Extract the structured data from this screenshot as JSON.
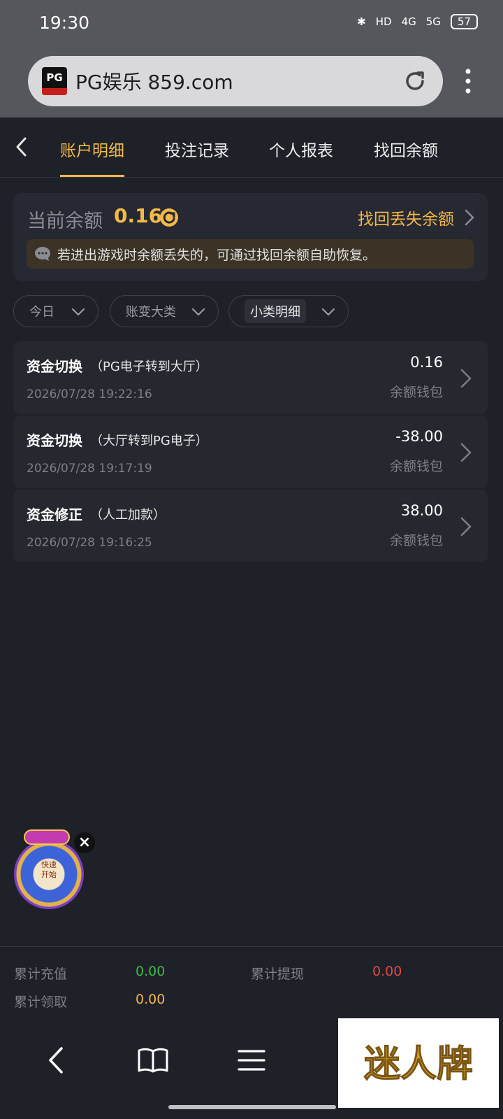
{
  "status_bar": {
    "time": "19:30",
    "network_1": "4G",
    "network_2": "5G",
    "hd": "HD",
    "battery": "57"
  },
  "browser": {
    "logo_text": "PG",
    "url": "PG娱乐 859.com"
  },
  "tabs": [
    {
      "label": "账户明细",
      "active": true
    },
    {
      "label": "投注记录",
      "active": false
    },
    {
      "label": "个人报表",
      "active": false
    },
    {
      "label": "找回余额",
      "active": false
    }
  ],
  "balance": {
    "label": "当前余额",
    "value": "0.16",
    "recover_link": "找回丢失余额",
    "notice": "若进出游戏时余额丢失的，可通过找回余额自助恢复。"
  },
  "filters": [
    {
      "label": "今日"
    },
    {
      "label": "账变大类"
    },
    {
      "label": "小类明细"
    }
  ],
  "records": [
    {
      "title": "资金切换",
      "note": "（PG电子转到大厅）",
      "time": "2026/07/28 19:22:16",
      "amount": "0.16",
      "wallet": "余额钱包"
    },
    {
      "title": "资金切换",
      "note": "（大厅转到PG电子）",
      "time": "2026/07/28 19:17:19",
      "amount": "-38.00",
      "wallet": "余额钱包"
    },
    {
      "title": "资金修正",
      "note": "（人工加款）",
      "time": "2026/07/28 19:16:25",
      "amount": "38.00",
      "wallet": "余额钱包"
    }
  ],
  "wheel": {
    "center_line1": "快速",
    "center_line2": "开始",
    "close": "×"
  },
  "summary": {
    "recharge_label": "累计充值",
    "recharge_value": "0.00",
    "withdraw_label": "累计提现",
    "withdraw_value": "0.00",
    "claim_label": "累计领取",
    "claim_value": "0.00"
  },
  "colors": {
    "accent": "#f3b949",
    "positive": "#3dbb4a",
    "negative": "#e0493f",
    "background": "#1f2129"
  },
  "watermark": {
    "text": "迷人牌"
  }
}
